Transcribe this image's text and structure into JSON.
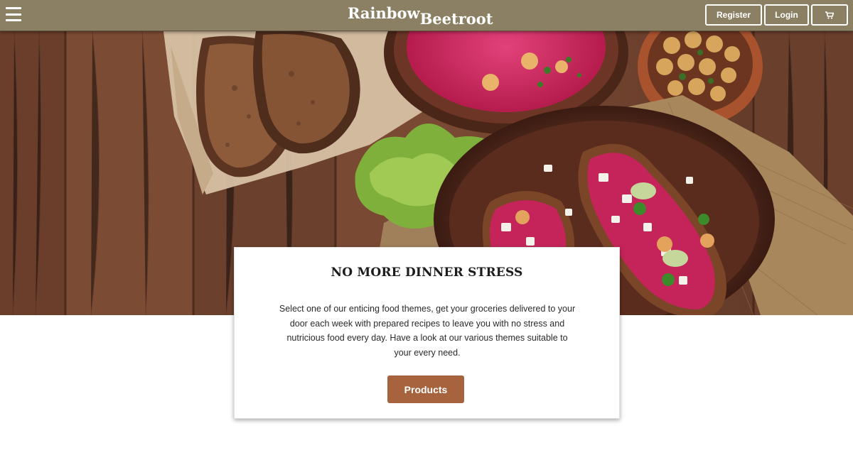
{
  "header": {
    "brand_part1": "Rainbow",
    "brand_part2": "Beetroot",
    "register_label": "Register",
    "login_label": "Login",
    "cart_icon": "cart-icon",
    "menu_icon": "hamburger-menu-icon"
  },
  "hero": {
    "image": "food-spread-hero-image"
  },
  "card": {
    "title": "NO MORE DINNER STRESS",
    "text": "Select one of our enticing food themes, get your groceries delivered to your door each week with prepared recipes to leave you with no stress and nutricious food every day. Have a look at our various themes suitable to your every need.",
    "button_label": "Products"
  },
  "colors": {
    "header_bg": "#8b7f64",
    "accent_button": "#a6633d",
    "beet_pink": "#c4245a"
  }
}
